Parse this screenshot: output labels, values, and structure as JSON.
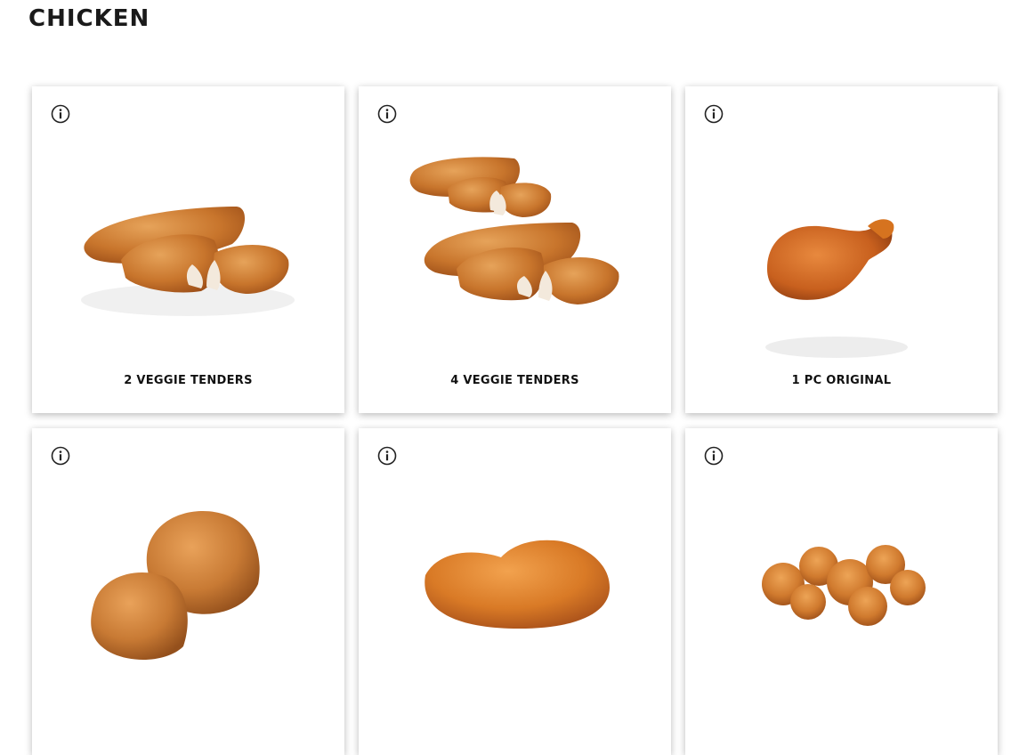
{
  "section": {
    "title": "CHICKEN"
  },
  "items": [
    {
      "label": "2 VEGGIE TENDERS",
      "image": "veggie-tenders-2",
      "info_icon": "info-icon"
    },
    {
      "label": "4 VEGGIE TENDERS",
      "image": "veggie-tenders-4",
      "info_icon": "info-icon"
    },
    {
      "label": "1 PC ORIGINAL",
      "image": "chicken-drumstick",
      "info_icon": "info-icon"
    },
    {
      "label": "",
      "image": "fried-chicken-pieces",
      "info_icon": "info-icon"
    },
    {
      "label": "",
      "image": "hot-crispy-chicken",
      "info_icon": "info-icon"
    },
    {
      "label": "",
      "image": "popcorn-chicken",
      "info_icon": "info-icon"
    }
  ],
  "colors": {
    "crust": "#c8752c",
    "crust_dark": "#9c4e18",
    "meat": "#f3e9dc",
    "text": "#111111"
  }
}
